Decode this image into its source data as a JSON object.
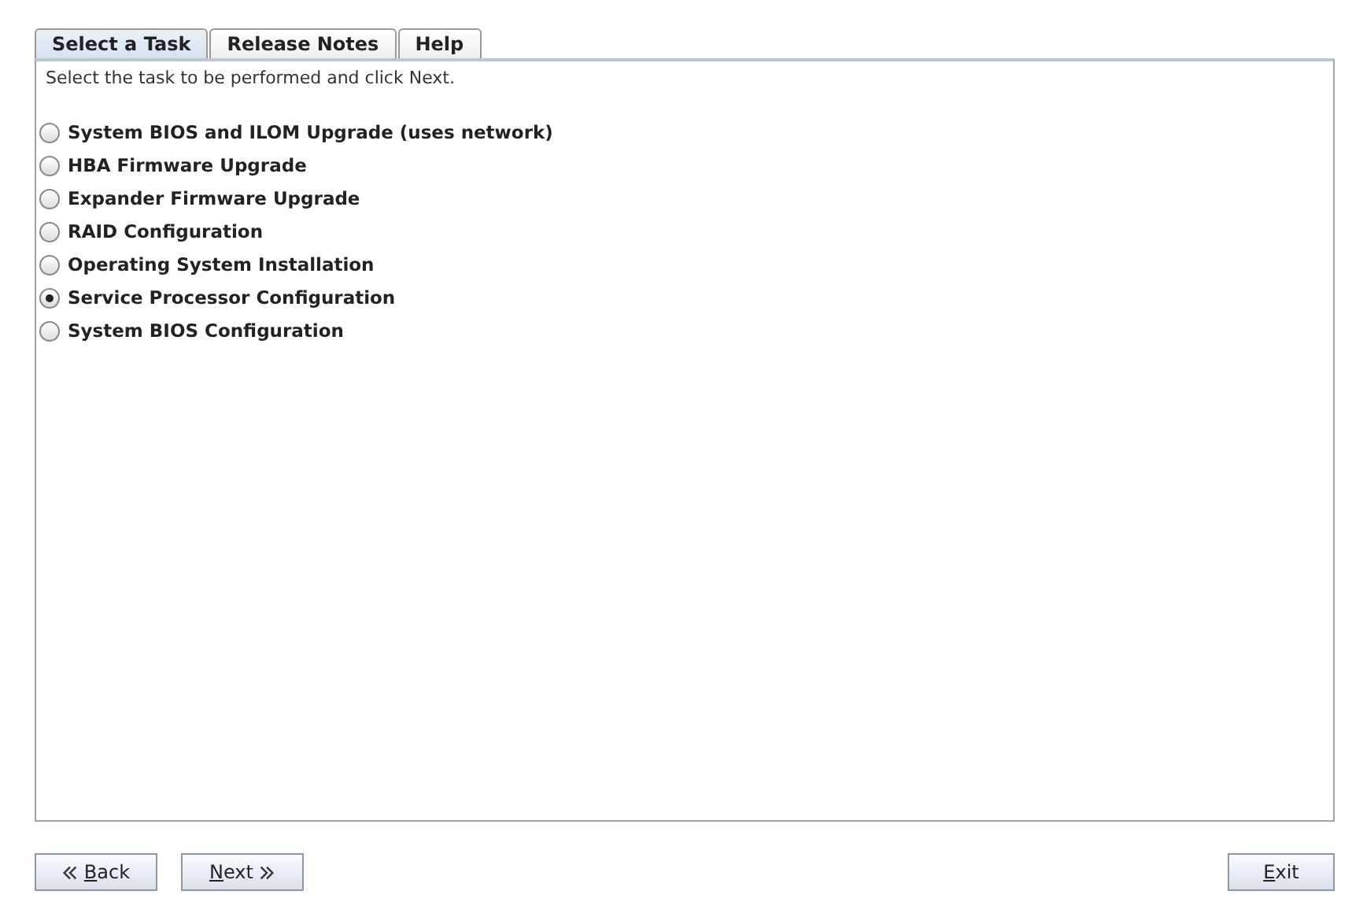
{
  "tabs": [
    {
      "label": "Select a Task",
      "selected": true
    },
    {
      "label": "Release Notes",
      "selected": false
    },
    {
      "label": "Help",
      "selected": false
    }
  ],
  "instruction": "Select the task to be performed and click Next.",
  "tasks": [
    {
      "label": "System BIOS and ILOM Upgrade (uses network)",
      "selected": false
    },
    {
      "label": "HBA Firmware Upgrade",
      "selected": false
    },
    {
      "label": "Expander Firmware Upgrade",
      "selected": false
    },
    {
      "label": "RAID Configuration",
      "selected": false
    },
    {
      "label": "Operating System Installation",
      "selected": false
    },
    {
      "label": "Service Processor Configuration",
      "selected": true
    },
    {
      "label": "System BIOS Configuration",
      "selected": false
    }
  ],
  "buttons": [
    {
      "label": "Back",
      "kind": "back"
    },
    {
      "label": "Next",
      "kind": "next"
    },
    {
      "label": "Exit",
      "kind": "exit"
    }
  ]
}
